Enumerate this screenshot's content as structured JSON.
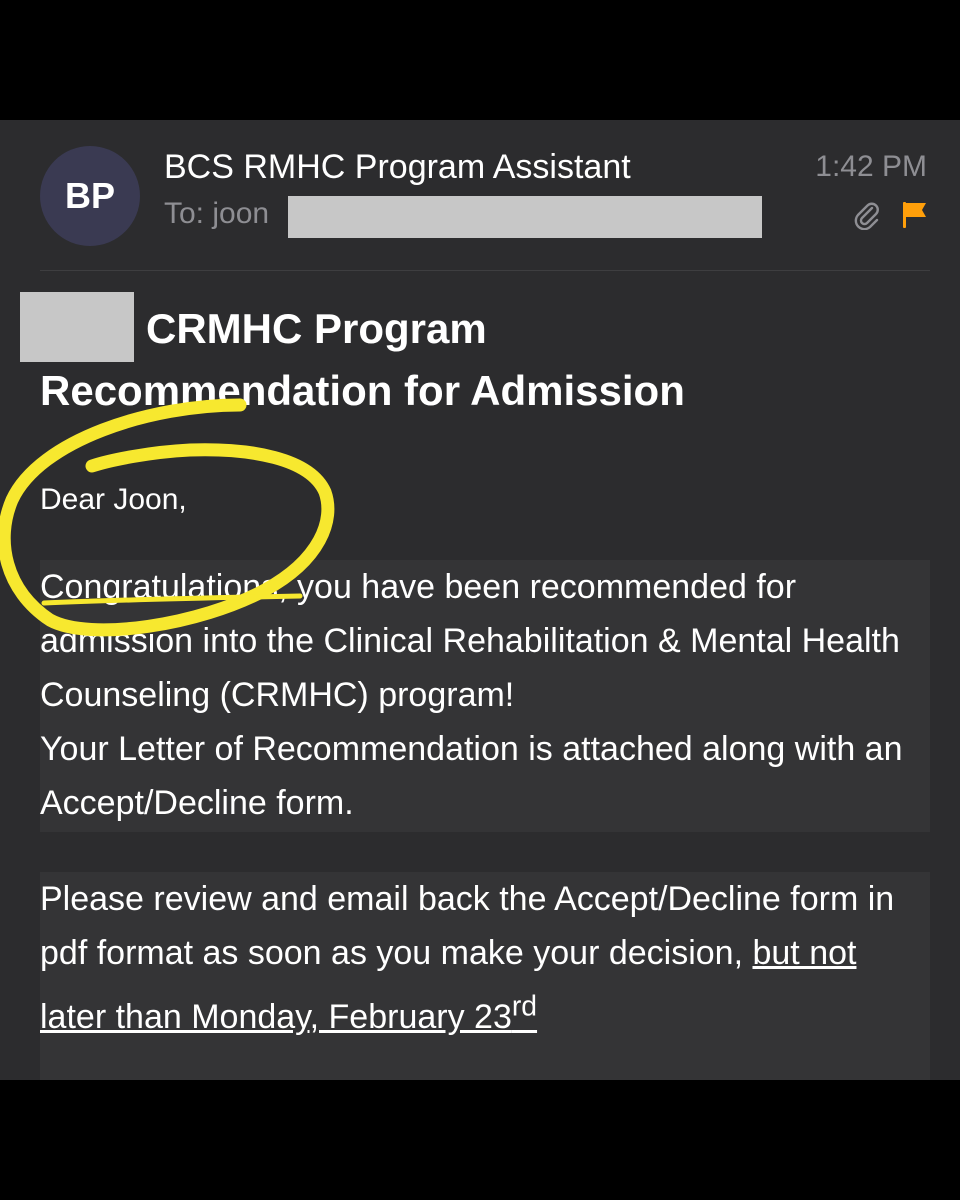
{
  "header": {
    "avatar_initials": "BP",
    "sender": "BCS RMHC Program Assistant",
    "to_label": "To:",
    "to_visible": "joon",
    "time": "1:42 PM",
    "icons": [
      "paperclip-icon",
      "flag-icon"
    ],
    "flag_color": "#ff9f0a"
  },
  "subject": {
    "line1": "CRMHC Program",
    "line2": "Recommendation for Admission"
  },
  "body": {
    "greeting": "Dear Joon,",
    "para1": "Congratulations, you have been recommended for admission into the Clinical Rehabilitation & Mental Health Counseling (CRMHC) program!",
    "para1b": "Your Letter of Recommendation is attached along with an Accept/Decline form.",
    "para2_start": "Please review and email back the Accept/Decline form in pdf format as soon as you make your decision,",
    "para2_underlined": "but not later than Monday, February 23",
    "para2_sup": "rd"
  },
  "annotation": {
    "circle_color": "#f7e82f"
  }
}
